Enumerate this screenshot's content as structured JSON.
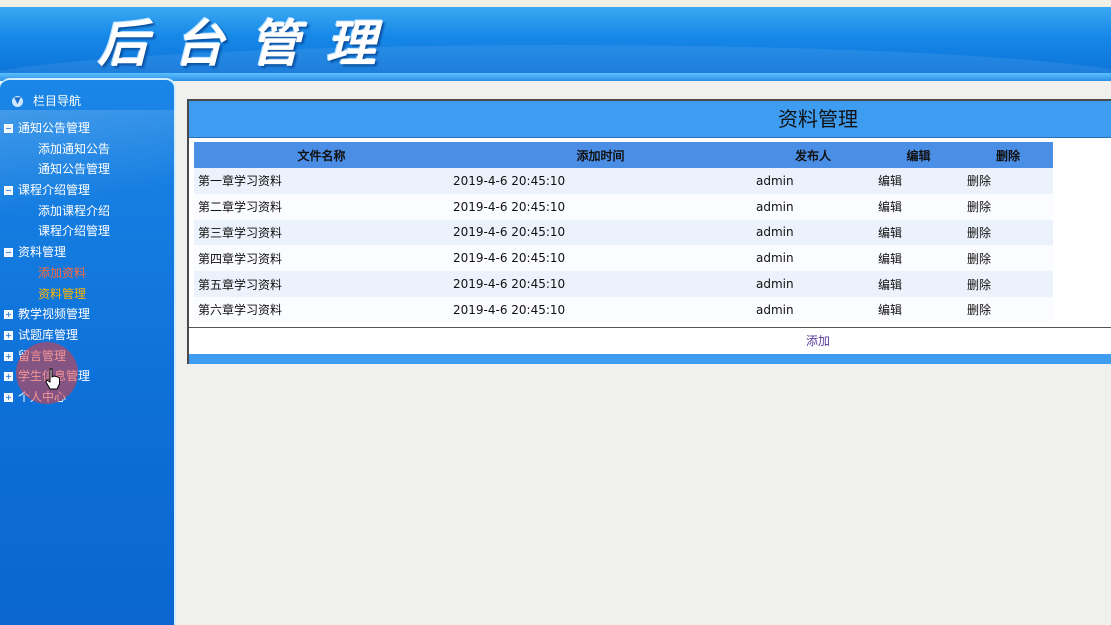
{
  "header": {
    "title": "后台管理"
  },
  "sidebar": {
    "heading": "栏目导航",
    "groups": [
      {
        "label": "通知公告管理",
        "expanded": true,
        "items": [
          "添加通知公告",
          "通知公告管理"
        ]
      },
      {
        "label": "课程介绍管理",
        "expanded": true,
        "items": [
          "添加课程介绍",
          "课程介绍管理"
        ]
      },
      {
        "label": "资料管理",
        "expanded": true,
        "items": [
          "添加资料",
          "资料管理"
        ]
      },
      {
        "label": "教学视频管理",
        "expanded": false,
        "items": []
      },
      {
        "label": "试题库管理",
        "expanded": false,
        "items": []
      },
      {
        "label": "留言管理",
        "expanded": false,
        "items": []
      },
      {
        "label": "学生信息管理",
        "expanded": false,
        "items": []
      },
      {
        "label": "个人中心",
        "expanded": false,
        "items": []
      }
    ]
  },
  "main": {
    "title": "资料管理",
    "columns": [
      "文件名称",
      "添加时间",
      "发布人",
      "编辑",
      "删除"
    ],
    "rows": [
      {
        "name": "第一章学习资料",
        "time": "2019-4-6 20:45:10",
        "publisher": "admin",
        "edit": "编辑",
        "delete": "删除"
      },
      {
        "name": "第二章学习资料",
        "time": "2019-4-6 20:45:10",
        "publisher": "admin",
        "edit": "编辑",
        "delete": "删除"
      },
      {
        "name": "第三章学习资料",
        "time": "2019-4-6 20:45:10",
        "publisher": "admin",
        "edit": "编辑",
        "delete": "删除"
      },
      {
        "name": "第四章学习资料",
        "time": "2019-4-6 20:45:10",
        "publisher": "admin",
        "edit": "编辑",
        "delete": "删除"
      },
      {
        "name": "第五章学习资料",
        "time": "2019-4-6 20:45:10",
        "publisher": "admin",
        "edit": "编辑",
        "delete": "删除"
      },
      {
        "name": "第六章学习资料",
        "time": "2019-4-6 20:45:10",
        "publisher": "admin",
        "edit": "编辑",
        "delete": "删除"
      }
    ],
    "add_label": "添加"
  },
  "colors": {
    "header_blue": "#1688e8",
    "sidebar_blue": "#0d6fd8",
    "panel_title_blue": "#3f9df1",
    "table_header_blue": "#4b8ee6",
    "active_item": "#ff6a3a",
    "current_item": "#ffb400"
  }
}
